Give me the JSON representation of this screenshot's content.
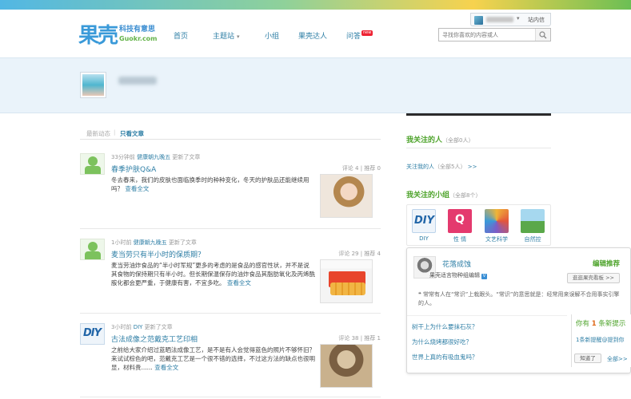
{
  "header": {
    "logo_mark": "果壳",
    "logo_slogan": "科技有意思",
    "logo_domain": "Guokr.com",
    "nav": [
      "首页",
      "主题站",
      "小组",
      "果壳达人",
      "问答"
    ],
    "new_badge": "new",
    "search_placeholder": "寻找你喜欢的内容或人",
    "user_menu": {
      "messages": "站内信"
    }
  },
  "tabs": {
    "all": "最新动态",
    "articles": "只看文章"
  },
  "feed": [
    {
      "time": "33分钟前",
      "author": "健康朝九晚五",
      "action": "更新了文章",
      "title": "春季护肤Q&A",
      "comments": "评论 4",
      "recommends": "推荐 0",
      "excerpt": "冬去春来，我们的皮肤也面临换季时的种种变化，冬天的护肤品还能继续用吗？",
      "more": "查看全文"
    },
    {
      "time": "1小时前",
      "author": "健康朝九晚五",
      "action": "更新了文章",
      "title": "麦当劳只有半小时的保质期？",
      "comments": "评论 29",
      "recommends": "推荐 4",
      "excerpt": "麦当劳油炸食品的“半小时军规”更多的考虑的是食品的感官性状，并不是说其食物的保持期只有半小时。但长期保温保存的油炸食品其脂肪氧化及丙烯酰胺化都会更严重，于健康有害，不宜多吃。",
      "more": "查看全文"
    },
    {
      "time": "3小时前",
      "author": "DIY",
      "action": "更新了文章",
      "title": "古法成像之范戴克工艺印相",
      "comments": "评论 38",
      "recommends": "推荐 1",
      "excerpt": "之前给大家介绍过蓝晒法成像工艺，是不是有人会觉得蓝色的照片不够怀旧？来试试棕色的吧，范戴克工艺是一个很不错的选择，不过这方法的缺点也很明显，材料贵......",
      "more": "查看全文"
    }
  ],
  "sidebar": {
    "following_people": {
      "title": "我关注的人",
      "count": "（全部0人）"
    },
    "followers_link": {
      "text": "关注我的人",
      "count": "（全部5人）",
      "arrow": ">>"
    },
    "following_groups": {
      "title": "我关注的小组",
      "count": "（全部8个）"
    },
    "groups": [
      {
        "name": "DIY",
        "icon": "diy-icon",
        "glyph": "DIY"
      },
      {
        "name": "性 情",
        "icon": "sex-icon",
        "glyph": "Q"
      },
      {
        "name": "文艺科学",
        "icon": "art-science-icon"
      },
      {
        "name": "自然控",
        "icon": "nature-icon"
      }
    ]
  },
  "recommend_popup": {
    "name": "花落成蚀",
    "role": "果壳适言物种组编辑",
    "verified": "V",
    "title": "编辑推荐",
    "swap_button": "逛逛果壳看板 >>",
    "quote": "常常有人在“常识”上栽跟头。“常识”的意思就是：经常用来误解不合用事实引擎的人。",
    "questions": [
      "树干上为什么要抹石灰？",
      "为什么烧烤都很好吃？",
      "世界上真的有吸血鬼吗？"
    ]
  },
  "notification": {
    "prefix": "你有",
    "count": "1",
    "suffix": "条新提示",
    "link": "1条新提醒@提到你",
    "dismiss": "知道了",
    "all": "全部>>"
  },
  "colors": {
    "accent_blue": "#2f7fa6",
    "accent_green": "#4da32a",
    "band": "#eaf3fa"
  }
}
